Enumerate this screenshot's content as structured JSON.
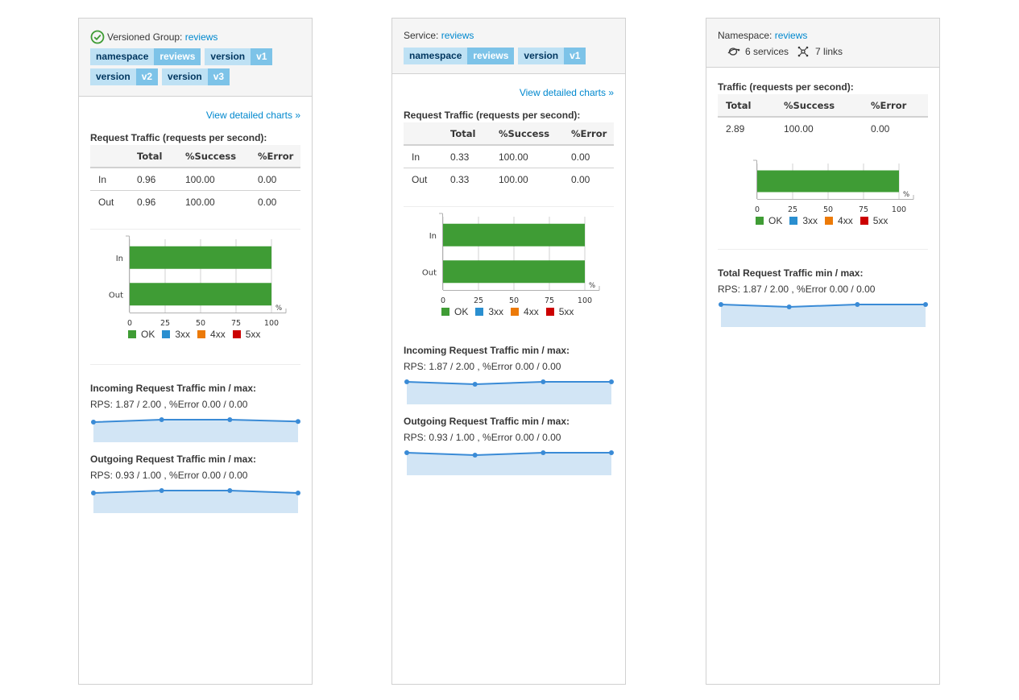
{
  "colors": {
    "ok": "#3f9c35",
    "c3xx": "#2a8fd0",
    "c4xx": "#ec7a08",
    "c5xx": "#cc0000",
    "accent": "#0088ce",
    "spark_line": "#3a8bd6",
    "spark_fill": "#d2e5f5"
  },
  "icons": {
    "success": "check-circle-icon",
    "services": "services-icon",
    "links": "links-icon"
  },
  "legend": [
    "OK",
    "3xx",
    "4xx",
    "5xx"
  ],
  "axis_ticks": [
    "0",
    "25",
    "50",
    "75",
    "100"
  ],
  "axis_unit": "%",
  "table_headers": [
    "",
    "Total",
    "%Success",
    "%Error"
  ],
  "panel1": {
    "title_prefix": "Versioned Group:",
    "title_link": "reviews",
    "labels": [
      {
        "key": "namespace",
        "value": "reviews"
      },
      {
        "key": "version",
        "value": "v1"
      },
      {
        "key": "version",
        "value": "v2"
      },
      {
        "key": "version",
        "value": "v3"
      }
    ],
    "detail_link": "View detailed charts »",
    "traffic_title": "Request Traffic (requests per second):",
    "rows": [
      {
        "dir": "In",
        "total": "0.96",
        "success": "100.00",
        "error": "0.00"
      },
      {
        "dir": "Out",
        "total": "0.96",
        "success": "100.00",
        "error": "0.00"
      }
    ],
    "in_title": "Incoming Request Traffic min / max:",
    "in_stats": "RPS: 1.87 / 2.00 , %Error 0.00 / 0.00",
    "out_title": "Outgoing Request Traffic min / max:",
    "out_stats": "RPS: 0.93 / 1.00 , %Error 0.00 / 0.00"
  },
  "panel2": {
    "title_prefix": "Service:",
    "title_link": "reviews",
    "labels": [
      {
        "key": "namespace",
        "value": "reviews"
      },
      {
        "key": "version",
        "value": "v1"
      }
    ],
    "detail_link": "View detailed charts »",
    "traffic_title": "Request Traffic (requests per second):",
    "rows": [
      {
        "dir": "In",
        "total": "0.33",
        "success": "100.00",
        "error": "0.00"
      },
      {
        "dir": "Out",
        "total": "0.33",
        "success": "100.00",
        "error": "0.00"
      }
    ],
    "in_title": "Incoming Request Traffic min / max:",
    "in_stats": "RPS: 1.87 / 2.00 , %Error 0.00 / 0.00",
    "out_title": "Outgoing Request Traffic min / max:",
    "out_stats": "RPS: 0.93 / 1.00 , %Error 0.00 / 0.00"
  },
  "panel3": {
    "title_prefix": "Namespace:",
    "title_link": "reviews",
    "services": "6 services",
    "links": "7 links",
    "traffic_title": "Traffic (requests per second):",
    "headers": [
      "Total",
      "%Success",
      "%Error"
    ],
    "row": {
      "total": "2.89",
      "success": "100.00",
      "error": "0.00"
    },
    "total_title": "Total Request Traffic min / max:",
    "total_stats": "RPS: 1.87 / 2.00 , %Error 0.00 / 0.00"
  },
  "chart_data": [
    {
      "type": "bar",
      "title": "",
      "categories": [
        "In",
        "Out"
      ],
      "series": [
        {
          "name": "OK",
          "values": [
            100,
            100
          ]
        },
        {
          "name": "3xx",
          "values": [
            0,
            0
          ]
        },
        {
          "name": "4xx",
          "values": [
            0,
            0
          ]
        },
        {
          "name": "5xx",
          "values": [
            0,
            0
          ]
        }
      ],
      "xlim": [
        0,
        100
      ],
      "xlabel": "%"
    },
    {
      "type": "line",
      "title": "Incoming Request Traffic min / max:",
      "values": [
        1.95,
        1.99,
        1.99,
        1.96
      ]
    },
    {
      "type": "line",
      "title": "Outgoing Request Traffic min / max:",
      "values": [
        0.96,
        0.99,
        0.99,
        0.96
      ]
    },
    {
      "type": "bar",
      "title": "",
      "categories": [
        "In",
        "Out"
      ],
      "series": [
        {
          "name": "OK",
          "values": [
            100,
            100
          ]
        },
        {
          "name": "3xx",
          "values": [
            0,
            0
          ]
        },
        {
          "name": "4xx",
          "values": [
            0,
            0
          ]
        },
        {
          "name": "5xx",
          "values": [
            0,
            0
          ]
        }
      ],
      "xlim": [
        0,
        100
      ],
      "xlabel": "%"
    },
    {
      "type": "line",
      "title": "Incoming Request Traffic min / max:",
      "values": [
        1.99,
        1.96,
        1.99,
        1.99
      ]
    },
    {
      "type": "line",
      "title": "Outgoing Request Traffic min / max:",
      "values": [
        0.99,
        0.97,
        0.99,
        0.99
      ]
    },
    {
      "type": "bar",
      "title": "",
      "categories": [
        ""
      ],
      "series": [
        {
          "name": "OK",
          "values": [
            100
          ]
        },
        {
          "name": "3xx",
          "values": [
            0
          ]
        },
        {
          "name": "4xx",
          "values": [
            0
          ]
        },
        {
          "name": "5xx",
          "values": [
            0
          ]
        }
      ],
      "xlim": [
        0,
        100
      ],
      "xlabel": "%"
    },
    {
      "type": "line",
      "title": "Total Request Traffic min / max:",
      "values": [
        1.99,
        1.96,
        1.99,
        1.99
      ]
    }
  ]
}
